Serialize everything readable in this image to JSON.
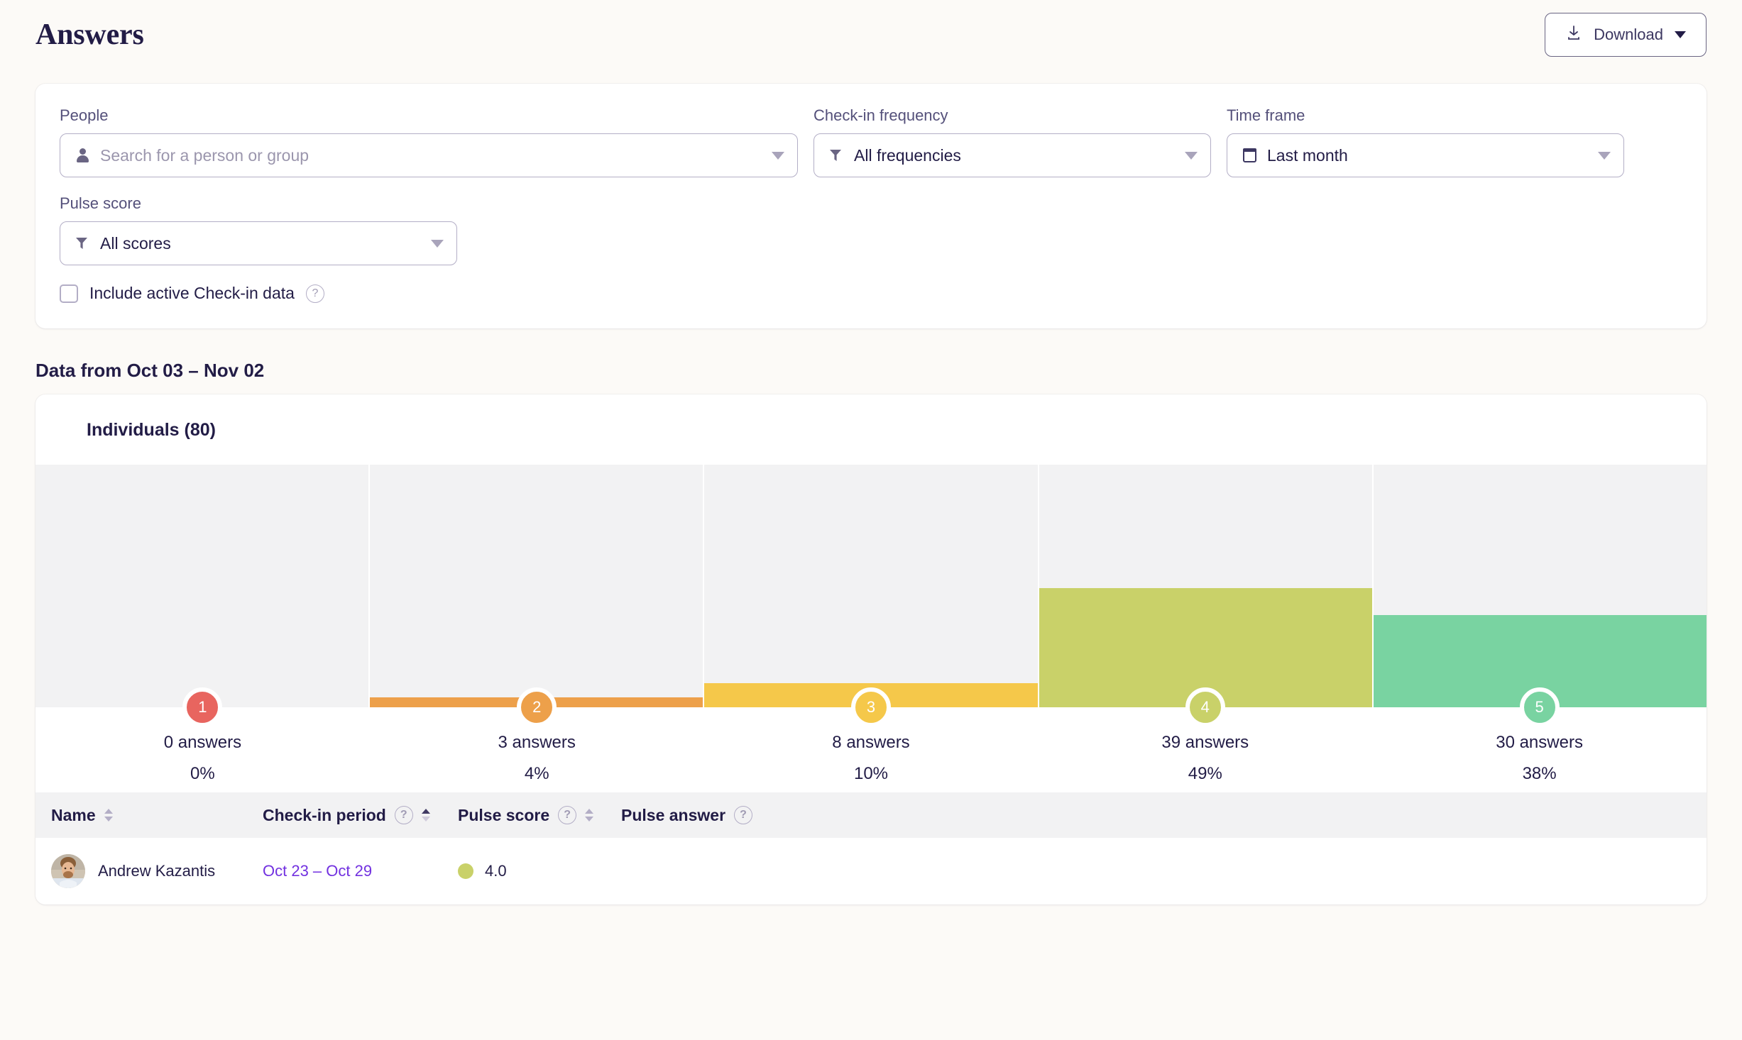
{
  "header": {
    "title": "Answers",
    "download_label": "Download",
    "download_icon": "download-icon",
    "caret_icon": "chevron-down-icon"
  },
  "filters": {
    "people": {
      "label": "People",
      "placeholder": "Search for a person or group",
      "value": "",
      "icon": "person-icon"
    },
    "frequency": {
      "label": "Check-in frequency",
      "value": "All frequencies",
      "icon": "filter-funnel-icon"
    },
    "timeframe": {
      "label": "Time frame",
      "value": "Last month",
      "icon": "calendar-icon"
    },
    "pulse_score": {
      "label": "Pulse score",
      "value": "All scores",
      "icon": "filter-funnel-icon"
    },
    "include_active": {
      "label": "Include active Check-in data",
      "checked": false,
      "help_icon": "help-circle-icon"
    }
  },
  "data_range": "Data from Oct 03 – Nov 02",
  "chart_card_title": "Individuals (80)",
  "chart_data": {
    "type": "bar",
    "title": "Individuals (80)",
    "xlabel": "",
    "ylabel": "",
    "categories": [
      "1",
      "2",
      "3",
      "4",
      "5"
    ],
    "values": [
      0,
      4,
      10,
      49,
      38
    ],
    "ylim": [
      0,
      100
    ],
    "grid": false,
    "legend": "none",
    "bars": [
      {
        "score": "1",
        "answers": "0 answers",
        "percent": "0%",
        "value": 0,
        "color": "#e8655f"
      },
      {
        "score": "2",
        "answers": "3 answers",
        "percent": "4%",
        "value": 4,
        "color": "#eda04a"
      },
      {
        "score": "3",
        "answers": "8 answers",
        "percent": "10%",
        "value": 10,
        "color": "#f5c84a"
      },
      {
        "score": "4",
        "answers": "39 answers",
        "percent": "49%",
        "value": 49,
        "color": "#c9d169"
      },
      {
        "score": "5",
        "answers": "30 answers",
        "percent": "38%",
        "value": 38,
        "color": "#79d3a1"
      }
    ],
    "track_color": "#f2f2f3"
  },
  "table": {
    "columns": [
      {
        "label": "Name",
        "sortable": true,
        "sort_state": "none",
        "help": false
      },
      {
        "label": "Check-in period",
        "sortable": true,
        "sort_state": "asc",
        "help": true
      },
      {
        "label": "Pulse score",
        "sortable": true,
        "sort_state": "none",
        "help": true
      },
      {
        "label": "Pulse answer",
        "sortable": false,
        "sort_state": "none",
        "help": true
      }
    ],
    "rows": [
      {
        "name": "Andrew Kazantis",
        "period": "Oct 23 – Oct 29",
        "score": "4.0",
        "score_color": "#c9d169",
        "answer": ""
      }
    ]
  },
  "colors": {
    "page_bg": "#fcfaf7",
    "text": "#221c46",
    "link": "#7231e0",
    "border": "#b3aec6"
  }
}
